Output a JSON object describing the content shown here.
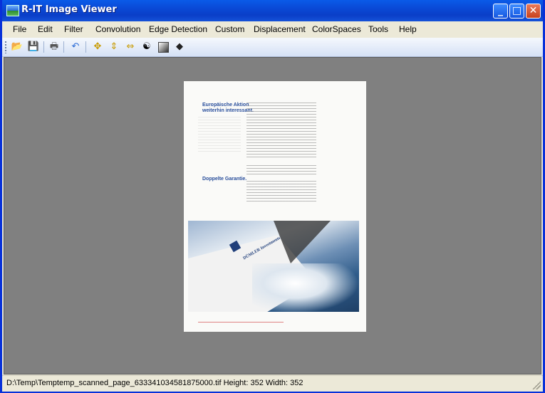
{
  "window": {
    "title": "R-IT Image Viewer"
  },
  "menu": [
    {
      "label": "File"
    },
    {
      "label": "Edit"
    },
    {
      "label": "Filter"
    },
    {
      "label": "Convolution"
    },
    {
      "label": "Edge Detection"
    },
    {
      "label": "Custom"
    },
    {
      "label": "Displacement"
    },
    {
      "label": "ColorSpaces"
    },
    {
      "label": "Tools"
    },
    {
      "label": "Help"
    }
  ],
  "toolbar": {
    "icons": [
      "open-folder-icon",
      "save-icon",
      "print-icon",
      "undo-icon",
      "move-icon",
      "fit-height-icon",
      "fit-width-icon",
      "yin-yang-icon",
      "gradient-icon",
      "3d-shape-icon"
    ]
  },
  "document": {
    "heading1": "Europäische Aktion weiterhin interessant.",
    "heading2": "Doppelte Garantie.",
    "brand": "DÜMLER Investments"
  },
  "status": {
    "text": "D:\\Temp\\Temptemp_scanned_page_633341034581875000.tif  Height: 352 Width: 352"
  }
}
